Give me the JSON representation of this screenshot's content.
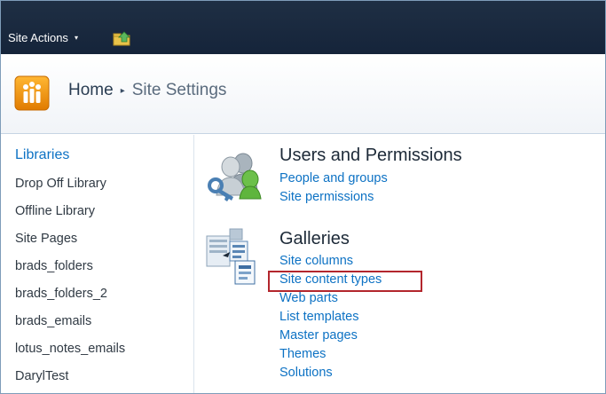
{
  "topbar": {
    "site_actions_label": "Site Actions",
    "site_actions_caret": "▾",
    "nav_up_icon": "navigate-up-icon"
  },
  "breadcrumb": {
    "home": "Home",
    "separator": "▸",
    "current": "Site Settings"
  },
  "leftnav": {
    "header": "Libraries",
    "items": [
      {
        "label": "Drop Off Library"
      },
      {
        "label": "Offline Library"
      },
      {
        "label": "Site Pages"
      },
      {
        "label": "brads_folders"
      },
      {
        "label": "brads_folders_2"
      },
      {
        "label": "brads_emails"
      },
      {
        "label": "lotus_notes_emails"
      },
      {
        "label": "DarylTest"
      }
    ]
  },
  "sections": {
    "users": {
      "title": "Users and Permissions",
      "icon": "users-permissions-icon",
      "links": [
        {
          "label": "People and groups"
        },
        {
          "label": "Site permissions"
        }
      ]
    },
    "galleries": {
      "title": "Galleries",
      "icon": "galleries-icon",
      "links": [
        {
          "label": "Site columns"
        },
        {
          "label": "Site content types"
        },
        {
          "label": "Web parts"
        },
        {
          "label": "List templates"
        },
        {
          "label": "Master pages"
        },
        {
          "label": "Themes"
        },
        {
          "label": "Solutions"
        }
      ]
    }
  },
  "colors": {
    "ribbon": "#1a2a3f",
    "link": "#0d72c4",
    "highlight": "#b3262d",
    "logo": "#f29100"
  }
}
